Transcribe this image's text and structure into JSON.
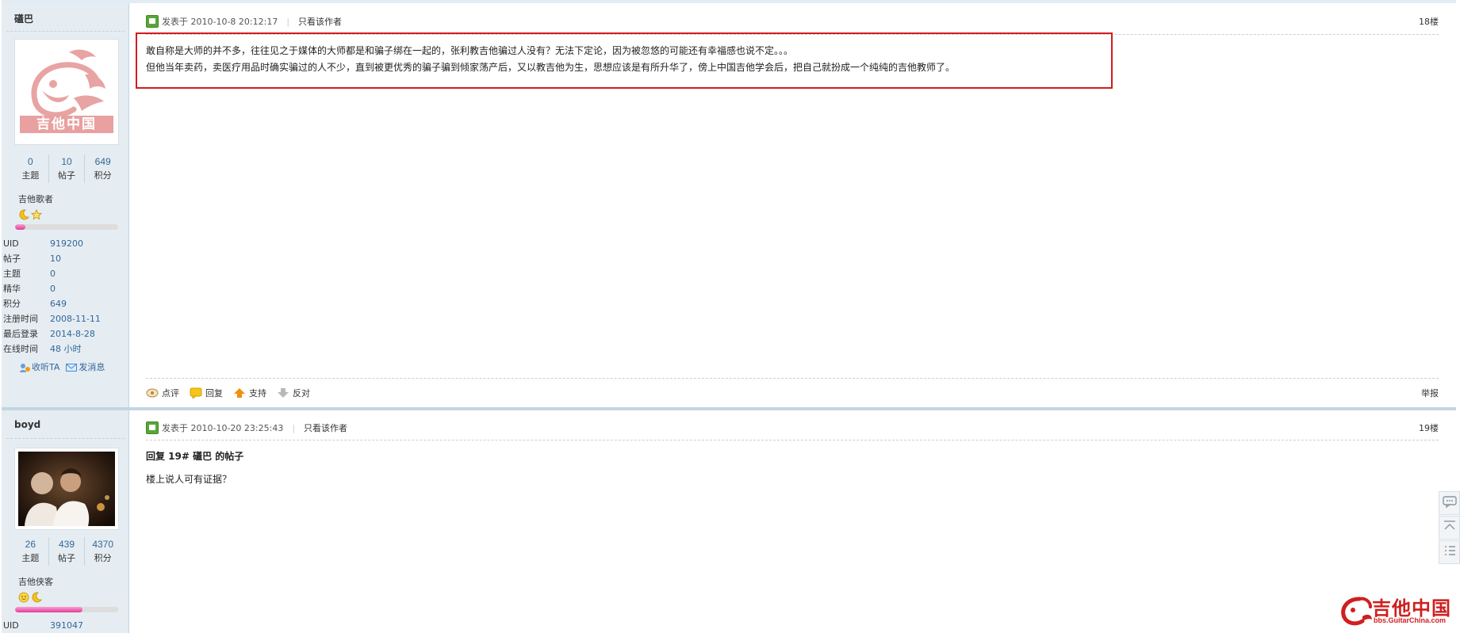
{
  "post1": {
    "author": "礚巴",
    "avatar": {
      "caption": "吉他中国"
    },
    "stats": [
      {
        "num": "0",
        "label": "主题"
      },
      {
        "num": "10",
        "label": "帖子"
      },
      {
        "num": "649",
        "label": "积分"
      }
    ],
    "grade": "吉他歌者",
    "grade_icons": [
      "moon-icon",
      "star-icon"
    ],
    "grade_progress": 0.1,
    "info": [
      {
        "k": "UID",
        "v": "919200"
      },
      {
        "k": "帖子",
        "v": "10"
      },
      {
        "k": "主题",
        "v": "0"
      },
      {
        "k": "精华",
        "v": "0"
      },
      {
        "k": "积分",
        "v": "649"
      },
      {
        "k": "注册时间",
        "v": "2008-11-11"
      },
      {
        "k": "最后登录",
        "v": "2014-8-28"
      },
      {
        "k": "在线时间",
        "v": "48 小时"
      }
    ],
    "listen_label": "收听TA",
    "message_label": "发消息",
    "posted": "发表于 2010-10-8 20:12:17",
    "only_author": "只看该作者",
    "floor": "18楼",
    "body_lines": [
      "敢自称是大师的并不多，往往见之于媒体的大师都是和骗子绑在一起的，张利教吉他骗过人没有？无法下定论，因为被忽悠的可能还有幸福感也说不定。。。",
      "但他当年卖药，卖医疗用品时确实骗过的人不少，直到被更优秀的骗子骗到倾家荡产后，又以教吉他为生，思想应该是有所升华了，傍上中国吉他学会后，把自己就扮成一个纯纯的吉他教师了。"
    ],
    "footer": {
      "rate": "点评",
      "reply": "回复",
      "support": "支持",
      "oppose": "反对",
      "report": "举报"
    }
  },
  "post2": {
    "author": "boyd",
    "stats": [
      {
        "num": "26",
        "label": "主题"
      },
      {
        "num": "439",
        "label": "帖子"
      },
      {
        "num": "4370",
        "label": "积分"
      }
    ],
    "grade": "吉他侠客",
    "grade_icons": [
      "sun-icon",
      "moon-icon"
    ],
    "grade_progress": 0.65,
    "info": [
      {
        "k": "UID",
        "v": "391047"
      }
    ],
    "posted": "发表于 2010-10-20 23:25:43",
    "only_author": "只看该作者",
    "floor": "19楼",
    "reply_title": "回复 19# 礚巴 的帖子",
    "reply_body": "楼上说人可有证据？"
  },
  "watermark": {
    "title": "吉他中国",
    "url": "bbs.GuitarChina.com"
  },
  "colors": {
    "highlight": "#d21c1c",
    "sidebar_bg": "#e5edf2",
    "link": "#336699",
    "brand_red": "#cf1f1f"
  }
}
